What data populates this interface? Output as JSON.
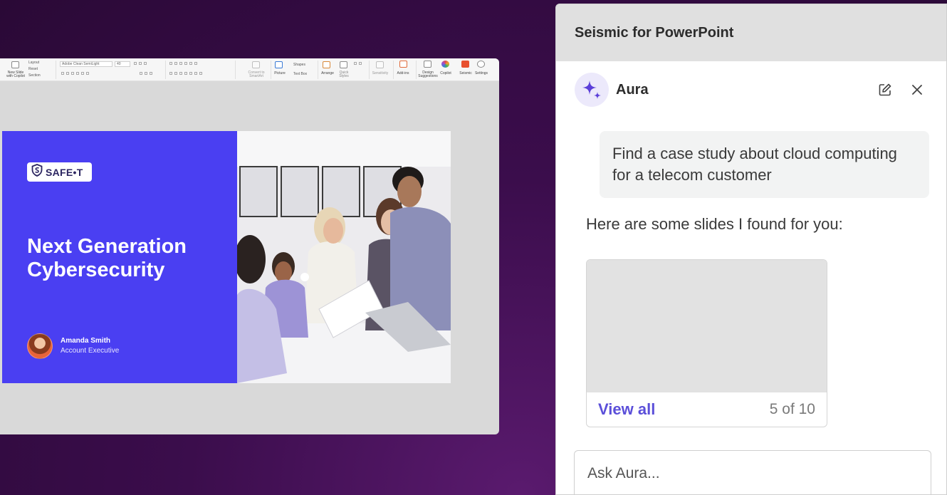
{
  "ribbon": {
    "new_slide": "New Slide",
    "with_copilot": "with Copilot",
    "layout": "Layout",
    "reset": "Reset",
    "section": "Section",
    "font_name": "Adobe Clean SemiLight",
    "font_size": "40",
    "convert": "Convert to",
    "smartart": "SmartArt",
    "picture": "Picture",
    "shapes": "Shapes",
    "text_box": "Text Box",
    "arrange": "Arrange",
    "quick": "Quick",
    "styles": "Styles",
    "sensitivity": "Sensitivity",
    "add_ins": "Add-ins",
    "design": "Design",
    "suggestions": "Suggestions",
    "copilot": "Copilot",
    "seismic": "Seismic",
    "settings": "Settings"
  },
  "slide": {
    "logo_text": "SAFE•T",
    "title_line1": "Next Generation",
    "title_line2": "Cybersecurity",
    "presenter_name": "Amanda Smith",
    "presenter_role": "Account Executive"
  },
  "panel": {
    "title": "Seismic for PowerPoint",
    "assistant_name": "Aura",
    "user_message": "Find a case study about cloud computing for a telecom customer",
    "assistant_message": "Here are some slides I found for you:",
    "result": {
      "view_all_label": "View all",
      "count_label": "5 of 10"
    },
    "input_placeholder": "Ask Aura..."
  },
  "colors": {
    "background": "#3b0d4c",
    "slide_accent": "#4a3ff2",
    "link": "#5b4fd9",
    "aura_star": "#5b3fd9"
  }
}
